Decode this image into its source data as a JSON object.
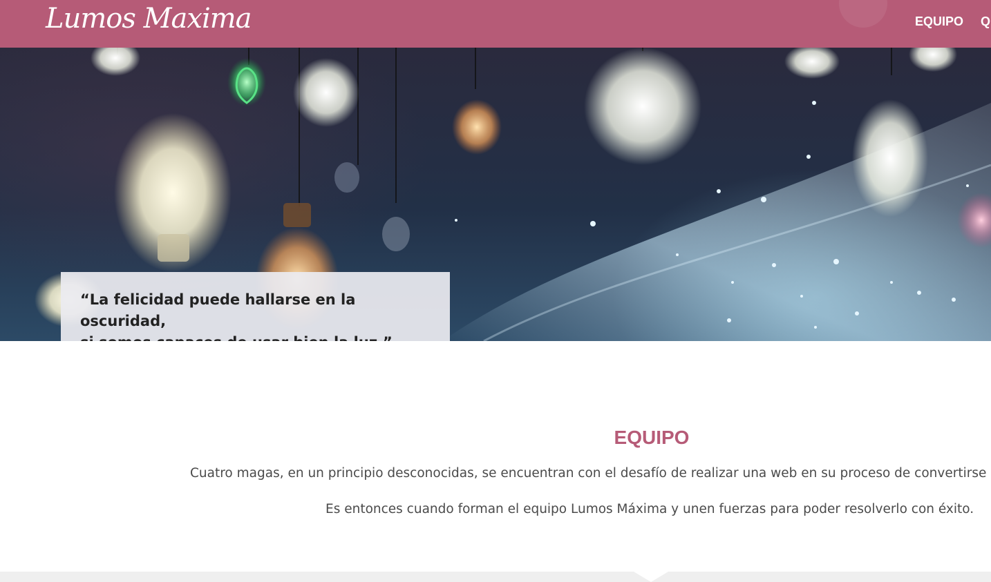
{
  "header": {
    "logo_text": "Lumos Maxima",
    "nav": [
      {
        "label": "EQUIPO"
      },
      {
        "label": "QU"
      }
    ]
  },
  "hero": {
    "quote_line1": "“La felicidad puede hallarse en la oscuridad,",
    "quote_line2": "si somos capaces de usar bien la luz.”"
  },
  "team": {
    "title": "EQUIPO",
    "paragraph1": "Cuatro magas, en un principio desconocidas, se encuentran con el desafío de realizar una web en su proceso de convertirse e",
    "paragraph2": "Es entonces cuando forman el equipo Lumos Máxima y unen fuerzas para poder resolverlo con éxito."
  },
  "colors": {
    "brand": "#b65b77",
    "text": "#4a4a4a",
    "quote_box": "#ebebf0"
  }
}
